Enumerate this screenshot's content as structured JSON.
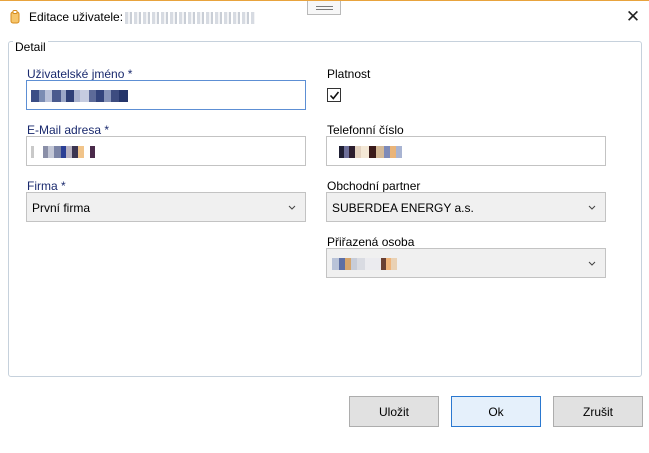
{
  "window": {
    "title": "Editace uživatele:",
    "close_glyph": "✕"
  },
  "detail": {
    "legend": "Detail",
    "username": {
      "label": "Uživatelské jméno *"
    },
    "validity": {
      "label": "Platnost",
      "checked": true
    },
    "email": {
      "label": "E-Mail adresa *"
    },
    "phone": {
      "label": "Telefonní číslo"
    },
    "company": {
      "label": "Firma *",
      "selected": "První firma"
    },
    "partner": {
      "label": "Obchodní partner",
      "selected": "SUBERDEA ENERGY a.s."
    },
    "assigned_person": {
      "label": "Přiřazená osoba"
    }
  },
  "buttons": {
    "save": "Uložit",
    "ok": "Ok",
    "cancel": "Zrušit"
  },
  "icons": {
    "title_icon": "user-badge-icon",
    "close": "close-icon",
    "check": "checkmark-icon",
    "dropdown": "chevron-down-icon"
  },
  "colors": {
    "accent_border": "#e8a33d",
    "focus_border": "#5d8fd4",
    "required_label": "#1a2a6e",
    "default_button_border": "#2a78d0"
  }
}
